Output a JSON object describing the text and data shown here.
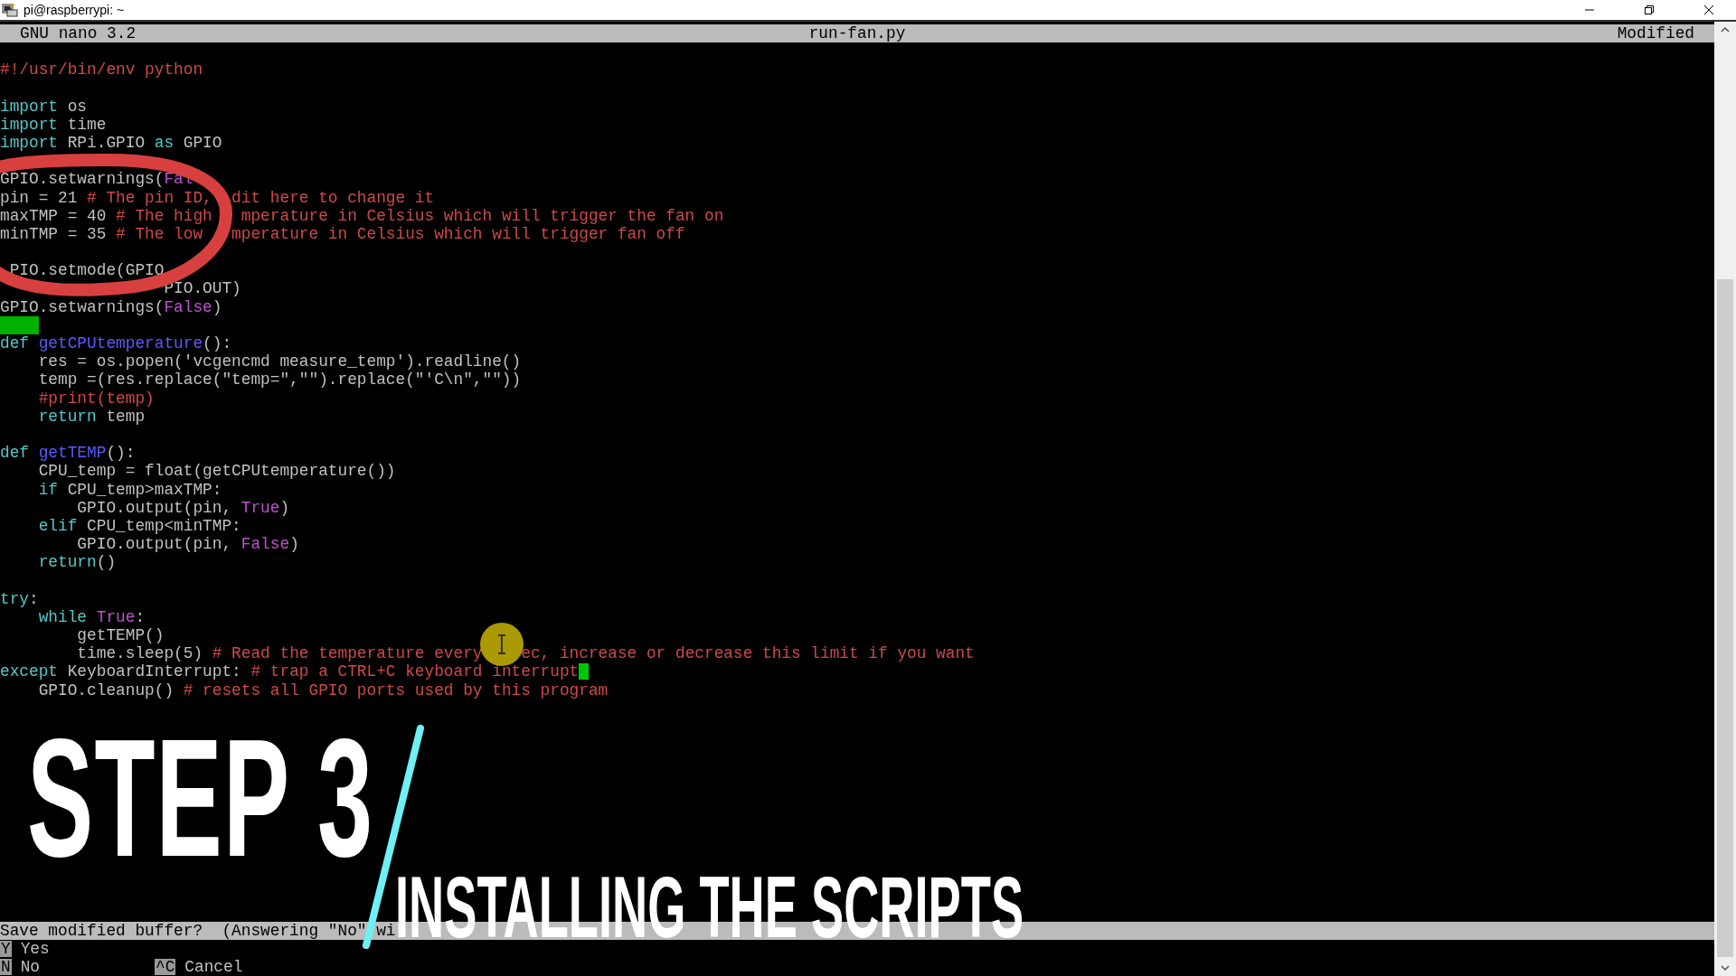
{
  "window": {
    "title": "pi@raspberrypi: ~"
  },
  "nano": {
    "version": "GNU nano 3.2",
    "filename": "run-fan.py",
    "status": "Modified"
  },
  "lines": [
    {
      "kind": "blank"
    },
    {
      "kind": "code",
      "segments": [
        {
          "kind": "comment",
          "text": "#!/usr/bin/env python"
        }
      ]
    },
    {
      "kind": "blank"
    },
    {
      "kind": "code",
      "segments": [
        {
          "kind": "keyword",
          "text": "import"
        },
        {
          "kind": "plain",
          "text": " os"
        }
      ]
    },
    {
      "kind": "code",
      "segments": [
        {
          "kind": "keyword",
          "text": "import"
        },
        {
          "kind": "plain",
          "text": " time"
        }
      ]
    },
    {
      "kind": "code",
      "segments": [
        {
          "kind": "keyword",
          "text": "import"
        },
        {
          "kind": "plain",
          "text": " RPi.GPIO "
        },
        {
          "kind": "keyword",
          "text": "as"
        },
        {
          "kind": "plain",
          "text": " GPIO"
        }
      ]
    },
    {
      "kind": "blank"
    },
    {
      "kind": "code",
      "segments": [
        {
          "kind": "plain",
          "text": "GPIO.setwarnings("
        },
        {
          "kind": "constant",
          "text": "Fal"
        }
      ]
    },
    {
      "kind": "code",
      "segments": [
        {
          "kind": "plain",
          "text": "pin = 21 "
        },
        {
          "kind": "comment",
          "text": "# The pin ID,"
        },
        {
          "kind": "comment",
          "text": "  dit here to change it"
        }
      ]
    },
    {
      "kind": "code",
      "segments": [
        {
          "kind": "plain",
          "text": "maxTMP = 40 "
        },
        {
          "kind": "comment",
          "text": "# The high"
        },
        {
          "kind": "comment",
          "text": "   mperature in Celsius which will trigger the fan on"
        }
      ]
    },
    {
      "kind": "code",
      "segments": [
        {
          "kind": "plain",
          "text": "minTMP = 35 "
        },
        {
          "kind": "comment",
          "text": "# The low"
        },
        {
          "kind": "comment",
          "text": "   mperature in Celsius which will trigger fan off"
        }
      ]
    },
    {
      "kind": "blank"
    },
    {
      "kind": "code",
      "segments": [
        {
          "kind": "plain",
          "text": " PIO.setmode(GPIO"
        }
      ]
    },
    {
      "kind": "code",
      "segments": [
        {
          "kind": "plain",
          "text": "                 PIO.OUT)"
        }
      ]
    },
    {
      "kind": "code",
      "segments": [
        {
          "kind": "plain",
          "text": "GPIO.setwarnings("
        },
        {
          "kind": "constant",
          "text": "False"
        },
        {
          "kind": "plain",
          "text": ")"
        }
      ]
    },
    {
      "kind": "whitespace"
    },
    {
      "kind": "code",
      "segments": [
        {
          "kind": "keyword",
          "text": "def "
        },
        {
          "kind": "function",
          "text": "getCPUtemperature"
        },
        {
          "kind": "plain",
          "text": "():"
        }
      ]
    },
    {
      "kind": "code",
      "segments": [
        {
          "kind": "plain",
          "text": "    res = os.popen('vcgencmd measure_temp').readline()"
        }
      ]
    },
    {
      "kind": "code",
      "segments": [
        {
          "kind": "plain",
          "text": "    temp =(res.replace(\"temp=\",\"\").replace(\"'C\\n\",\"\"))"
        }
      ]
    },
    {
      "kind": "code",
      "segments": [
        {
          "kind": "comment",
          "text": "    #print(temp)"
        }
      ]
    },
    {
      "kind": "code",
      "segments": [
        {
          "kind": "keyword",
          "text": "    return"
        },
        {
          "kind": "plain",
          "text": " temp"
        }
      ]
    },
    {
      "kind": "blank"
    },
    {
      "kind": "code",
      "segments": [
        {
          "kind": "keyword",
          "text": "def "
        },
        {
          "kind": "function",
          "text": "getTEMP"
        },
        {
          "kind": "plain",
          "text": "():"
        }
      ]
    },
    {
      "kind": "code",
      "segments": [
        {
          "kind": "plain",
          "text": "    CPU_temp = float(getCPUtemperature())"
        }
      ]
    },
    {
      "kind": "code",
      "segments": [
        {
          "kind": "keyword",
          "text": "    if"
        },
        {
          "kind": "plain",
          "text": " CPU_temp>maxTMP:"
        }
      ]
    },
    {
      "kind": "code",
      "segments": [
        {
          "kind": "plain",
          "text": "        GPIO.output(pin, "
        },
        {
          "kind": "constant",
          "text": "True"
        },
        {
          "kind": "plain",
          "text": ")"
        }
      ]
    },
    {
      "kind": "code",
      "segments": [
        {
          "kind": "keyword",
          "text": "    elif"
        },
        {
          "kind": "plain",
          "text": " CPU_temp<minTMP:"
        }
      ]
    },
    {
      "kind": "code",
      "segments": [
        {
          "kind": "plain",
          "text": "        GPIO.output(pin, "
        },
        {
          "kind": "constant",
          "text": "False"
        },
        {
          "kind": "plain",
          "text": ")"
        }
      ]
    },
    {
      "kind": "code",
      "segments": [
        {
          "kind": "keyword",
          "text": "    return"
        },
        {
          "kind": "plain",
          "text": "()"
        }
      ]
    },
    {
      "kind": "blank"
    },
    {
      "kind": "code",
      "segments": [
        {
          "kind": "keyword",
          "text": "try"
        },
        {
          "kind": "plain",
          "text": ":"
        }
      ]
    },
    {
      "kind": "code",
      "segments": [
        {
          "kind": "keyword",
          "text": "    while "
        },
        {
          "kind": "constant",
          "text": "True"
        },
        {
          "kind": "plain",
          "text": ":"
        }
      ]
    },
    {
      "kind": "code",
      "segments": [
        {
          "kind": "plain",
          "text": "        getTEMP()"
        }
      ]
    },
    {
      "kind": "code",
      "segments": [
        {
          "kind": "plain",
          "text": "        time.sleep(5) "
        },
        {
          "kind": "comment",
          "text": "# Read the temperature every"
        },
        {
          "kind": "comment",
          "text": "    ec, increase or decrease this limit if you want"
        }
      ]
    },
    {
      "kind": "code",
      "segments": [
        {
          "kind": "keyword",
          "text": "except"
        },
        {
          "kind": "plain",
          "text": " KeyboardInterrupt: "
        },
        {
          "kind": "comment",
          "text": "# trap a CTRL+C keyboard interrupt"
        },
        {
          "kind": "cursor"
        }
      ]
    },
    {
      "kind": "code",
      "segments": [
        {
          "kind": "plain",
          "text": "    GPIO.cleanup() "
        },
        {
          "kind": "comment",
          "text": "# resets all GPIO ports used by this program"
        }
      ]
    }
  ],
  "prompt": "Save modified buffer?  (Answering \"No\" wi",
  "shortcuts": [
    [
      {
        "key": "Y",
        "label": "Yes"
      }
    ],
    [
      {
        "key": "N",
        "label": "No"
      },
      {
        "key": "^C",
        "label": "Cancel"
      }
    ]
  ],
  "overlay": {
    "title": "STEP 3",
    "subtitle": "INSTALLING THE SCRIPTS"
  }
}
